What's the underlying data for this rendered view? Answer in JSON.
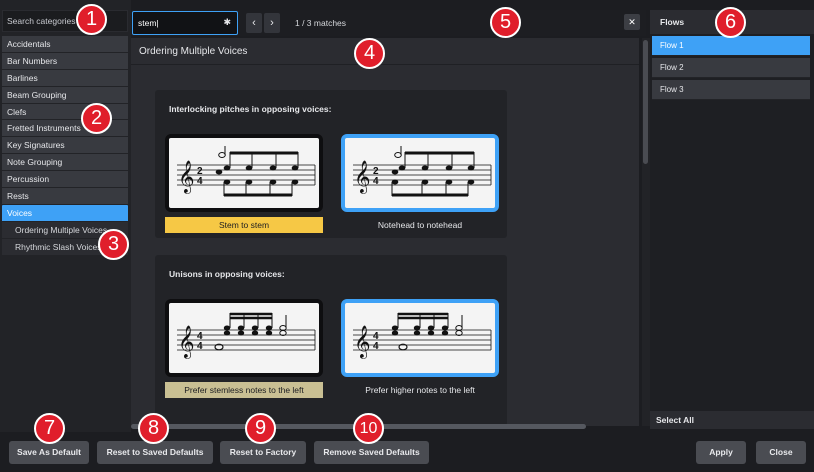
{
  "categories": {
    "search_placeholder": "Search categories",
    "items": [
      "Accidentals",
      "Bar Numbers",
      "Barlines",
      "Beam Grouping",
      "Clefs",
      "Fretted Instruments",
      "Key Signatures",
      "Note Grouping",
      "Percussion",
      "Rests",
      "Voices"
    ],
    "active": "Voices",
    "subitems": [
      "Ordering Multiple Voices",
      "Rhythmic Slash Voices"
    ]
  },
  "find": {
    "value": "stem",
    "clear_icon": "close-icon",
    "prev_icon": "chevron-left-icon",
    "next_icon": "chevron-right-icon",
    "matches": "1 / 3 matches",
    "close_icon": "close-icon"
  },
  "main": {
    "title": "Ordering Multiple Voices",
    "panels": [
      {
        "title": "Interlocking pitches in opposing voices:",
        "options": [
          {
            "label": "Stem to stem",
            "selected": true
          },
          {
            "label": "Notehead to notehead",
            "selected": false
          }
        ]
      },
      {
        "title": "Unisons in opposing voices:",
        "options": [
          {
            "label": "Prefer stemless notes to the left",
            "selected": true
          },
          {
            "label": "Prefer higher notes to the left",
            "selected": false
          }
        ]
      }
    ]
  },
  "flows": {
    "title": "Flows",
    "items": [
      "Flow 1",
      "Flow 2",
      "Flow 3"
    ],
    "active": "Flow 1",
    "select_all": "Select All"
  },
  "buttons": {
    "save_default": "Save As Default",
    "reset_saved": "Reset to Saved Defaults",
    "reset_factory": "Reset to Factory",
    "remove_saved": "Remove Saved Defaults",
    "apply": "Apply",
    "close": "Close"
  },
  "callouts": [
    "1",
    "2",
    "3",
    "4",
    "5",
    "6",
    "7",
    "8",
    "9",
    "10"
  ],
  "colors": {
    "accent": "#3ea1f6",
    "callout": "#e01e2b",
    "highlight_yellow": "#f6c845",
    "highlight_tan": "#c9bf93"
  }
}
